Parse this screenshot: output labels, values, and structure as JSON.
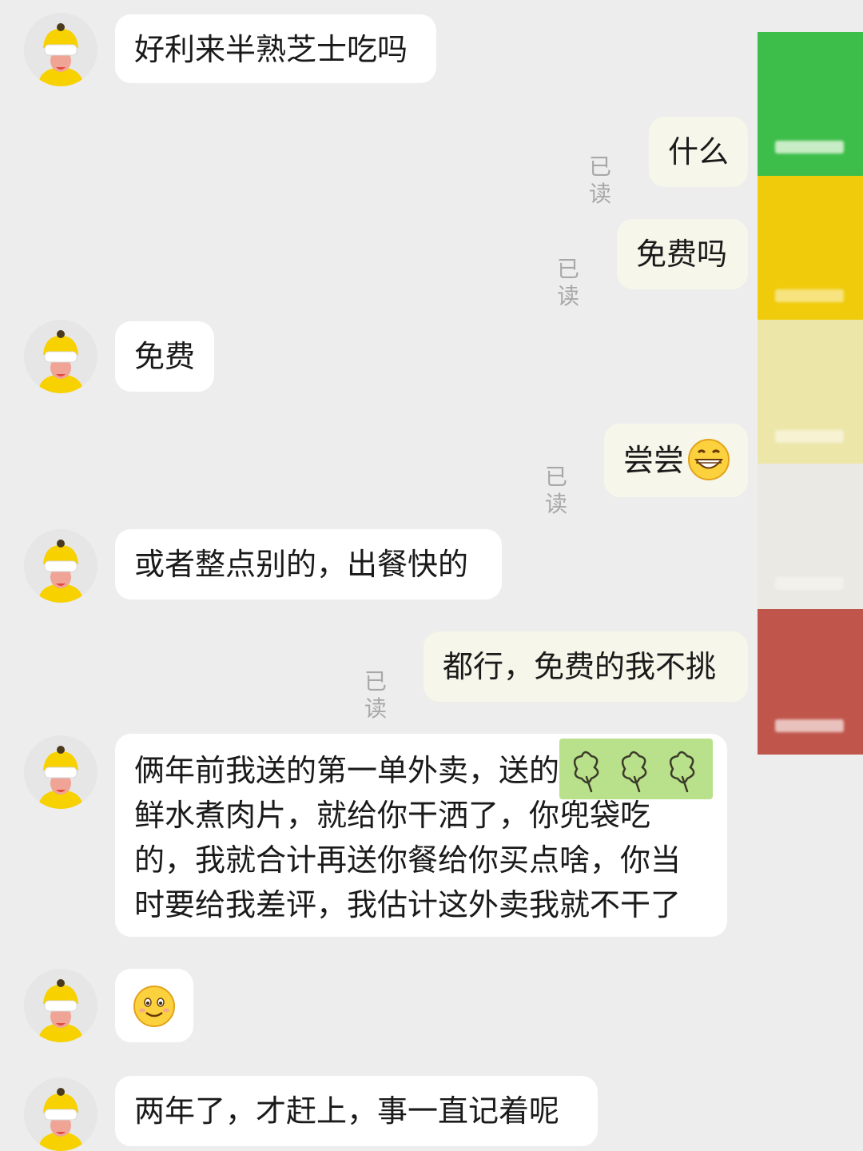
{
  "conversation": {
    "messages": [
      {
        "side": "them",
        "text": "好利来半熟芝士吃吗"
      },
      {
        "side": "me",
        "text": "什么",
        "status": "已读"
      },
      {
        "side": "me",
        "text": "免费吗",
        "status": "已读"
      },
      {
        "side": "them",
        "text": "免费"
      },
      {
        "side": "me",
        "text": "尝尝",
        "status": "已读",
        "emoji": "grinning-face-emoji"
      },
      {
        "side": "them",
        "text": "或者整点别的，出餐快的"
      },
      {
        "side": "me",
        "text": "都行，免费的我不挑",
        "status": "已读"
      },
      {
        "side": "them",
        "lines": [
          "俩年前我送的第一单外卖，送的",
          "鲜水煮肉片，就给你干洒了，你兜袋吃",
          "的，我就合计再送你餐给你买点啥，你当",
          "时要给我差评，我估计这外卖我就不干了"
        ],
        "sticker": "clover-sticker"
      },
      {
        "side": "them",
        "emoji": "smiling-face-emoji"
      },
      {
        "side": "them",
        "text": "两年了，才赶上，事一直记着呢"
      }
    ]
  },
  "colors": {
    "background": "#ededed",
    "bubble_them": "#ffffff",
    "bubble_me": "#f6f6ea",
    "read_status": "#a8a8a8",
    "strip": [
      "#3dbe4a",
      "#efcb0b",
      "#ece6a9",
      "#ebe9e3",
      "#c0554c"
    ]
  },
  "icons": {
    "avatar": "delivery-rider-avatar-icon"
  }
}
